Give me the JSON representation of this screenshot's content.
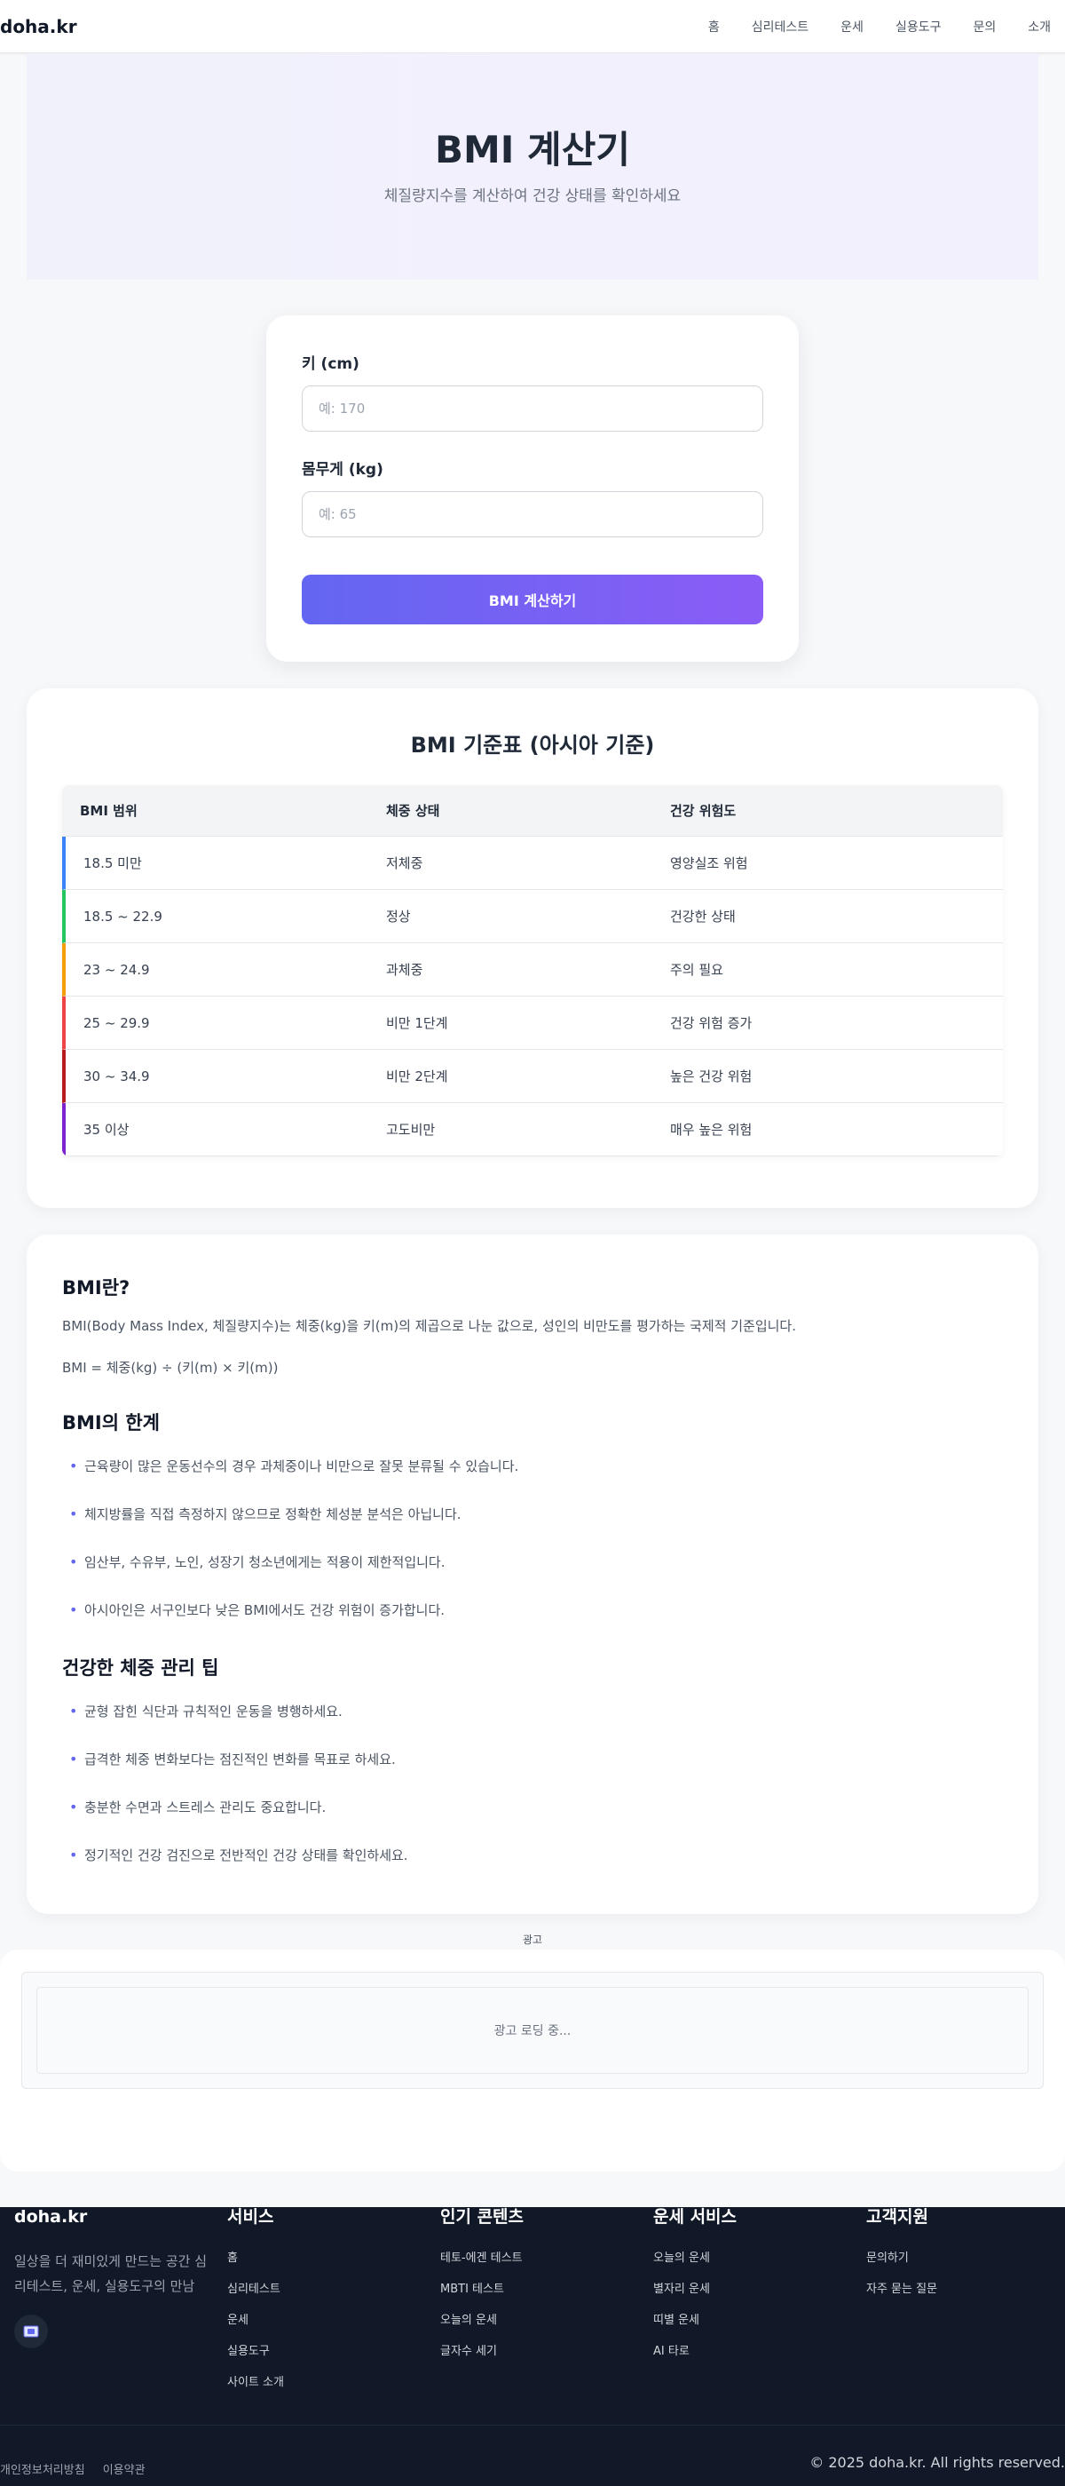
{
  "header": {
    "logo": "doha.kr",
    "nav": [
      "홈",
      "심리테스트",
      "운세",
      "실용도구",
      "문의",
      "소개"
    ]
  },
  "hero": {
    "title": "BMI 계산기",
    "subtitle": "체질량지수를 계산하여 건강 상태를 확인하세요"
  },
  "calculator": {
    "height_label": "키 (cm)",
    "height_placeholder": "예: 170",
    "weight_label": "몸무게 (kg)",
    "weight_placeholder": "예: 65",
    "button_label": "BMI 계산하기"
  },
  "table": {
    "title": "BMI 기준표 (아시아 기준)",
    "headers": [
      "BMI 범위",
      "체중 상태",
      "건강 위험도"
    ],
    "rows": [
      {
        "range": "18.5 미만",
        "status": "저체중",
        "risk": "영양실조 위험",
        "color": "#3b82f6"
      },
      {
        "range": "18.5 ~ 22.9",
        "status": "정상",
        "risk": "건강한 상태",
        "color": "#22c55e"
      },
      {
        "range": "23 ~ 24.9",
        "status": "과체중",
        "risk": "주의 필요",
        "color": "#f59e0b"
      },
      {
        "range": "25 ~ 29.9",
        "status": "비만 1단계",
        "risk": "건강 위험 증가",
        "color": "#ef4444"
      },
      {
        "range": "30 ~ 34.9",
        "status": "비만 2단계",
        "risk": "높은 건강 위험",
        "color": "#b91c1c"
      },
      {
        "range": "35 이상",
        "status": "고도비만",
        "risk": "매우 높은 위험",
        "color": "#7e22ce"
      }
    ]
  },
  "info": {
    "what_title": "BMI란?",
    "what_text": "BMI(Body Mass Index, 체질량지수)는 체중(kg)을 키(m)의 제곱으로 나눈 값으로, 성인의 비만도를 평가하는 국제적 기준입니다.",
    "formula": "BMI = 체중(kg) ÷ (키(m) × 키(m))",
    "limits_title": "BMI의 한계",
    "limits": [
      "근육량이 많은 운동선수의 경우 과체중이나 비만으로 잘못 분류될 수 있습니다.",
      "체지방률을 직접 측정하지 않으므로 정확한 체성분 분석은 아닙니다.",
      "임산부, 수유부, 노인, 성장기 청소년에게는 적용이 제한적입니다.",
      "아시아인은 서구인보다 낮은 BMI에서도 건강 위험이 증가합니다."
    ],
    "tips_title": "건강한 체중 관리 팁",
    "tips": [
      "균형 잡힌 식단과 규칙적인 운동을 병행하세요.",
      "급격한 체중 변화보다는 점진적인 변화를 목표로 하세요.",
      "충분한 수면과 스트레스 관리도 중요합니다.",
      "정기적인 건강 검진으로 전반적인 건강 상태를 확인하세요."
    ]
  },
  "ad": {
    "label": "광고",
    "loading": "광고 로딩 중..."
  },
  "footer": {
    "brand": "doha.kr",
    "description": "일상을 더 재미있게 만드는 공간 심리테스트, 운세, 실용도구의 만남",
    "icon": "email-icon",
    "columns": [
      {
        "title": "서비스",
        "items": [
          "홈",
          "심리테스트",
          "운세",
          "실용도구",
          "사이트 소개"
        ]
      },
      {
        "title": "인기 콘텐츠",
        "items": [
          "테토-에겐 테스트",
          "MBTI 테스트",
          "오늘의 운세",
          "글자수 세기"
        ]
      },
      {
        "title": "운세 서비스",
        "items": [
          "오늘의 운세",
          "별자리 운세",
          "띠별 운세",
          "AI 타로"
        ]
      },
      {
        "title": "고객지원",
        "items": [
          "문의하기",
          "자주 묻는 질문"
        ]
      }
    ],
    "bottom_links": [
      "개인정보처리방침",
      "이용약관"
    ],
    "copyright": "© 2025 doha.kr. All rights reserved."
  }
}
